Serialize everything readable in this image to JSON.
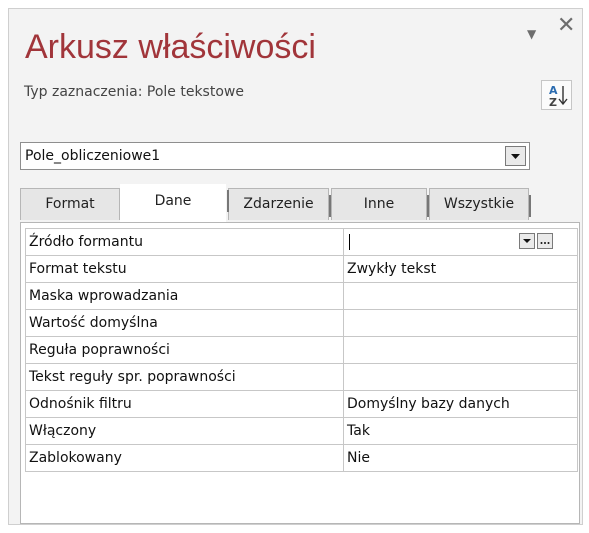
{
  "header": {
    "title": "Arkusz właściwości",
    "selection_type": "Typ zaznaczenia:  Pole tekstowe"
  },
  "window_controls": {
    "menu_icon": "dropdown-arrow-icon",
    "close_icon": "close-icon"
  },
  "sort_button": {
    "icon": "sort-az-icon"
  },
  "object_selector": {
    "value": "Pole_obliczeniowe1"
  },
  "tabs": [
    {
      "label": "Format",
      "active": false
    },
    {
      "label": "Dane",
      "active": true
    },
    {
      "label": "Zdarzenie",
      "active": false
    },
    {
      "label": "Inne",
      "active": false
    },
    {
      "label": "Wszystkie",
      "active": false
    }
  ],
  "properties": [
    {
      "name": "Źródło formantu",
      "value": ""
    },
    {
      "name": "Format tekstu",
      "value": "Zwykły tekst"
    },
    {
      "name": "Maska wprowadzania",
      "value": ""
    },
    {
      "name": "Wartość domyślna",
      "value": ""
    },
    {
      "name": "Reguła poprawności",
      "value": ""
    },
    {
      "name": "Tekst reguły spr. poprawności",
      "value": ""
    },
    {
      "name": "Odnośnik filtru",
      "value": "Domyślny bazy danych"
    },
    {
      "name": "Włączony",
      "value": "Tak"
    },
    {
      "name": "Zablokowany",
      "value": "Nie"
    }
  ],
  "colors": {
    "title": "#a1353a",
    "background": "#f3f3f3"
  }
}
